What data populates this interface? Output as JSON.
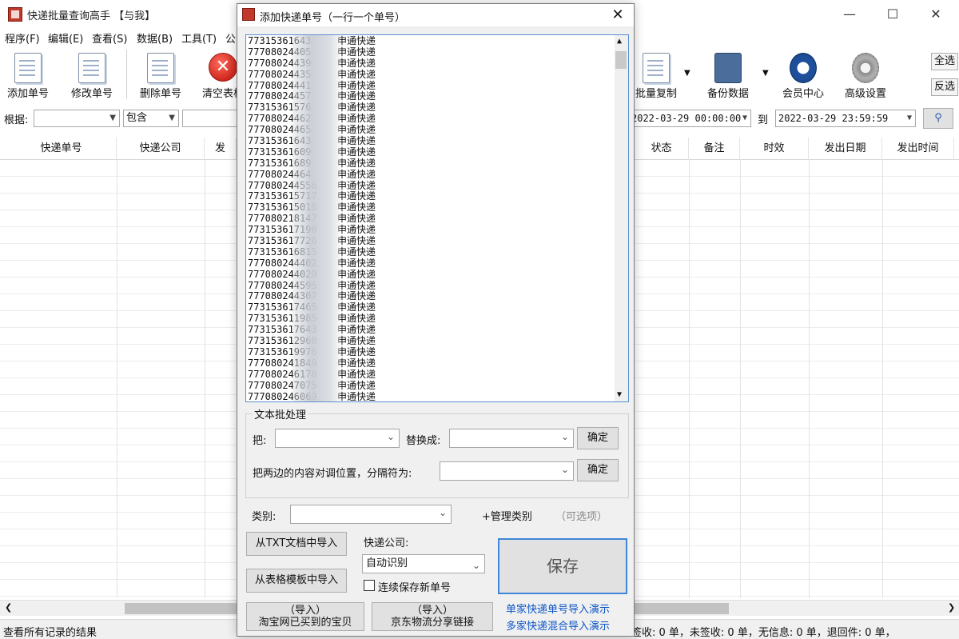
{
  "window": {
    "title": "快递批量查询高手 【与我】",
    "controls": {
      "minimize": "—",
      "maximize": "☐",
      "close": "✕"
    }
  },
  "menu": [
    "程序(F)",
    "编辑(E)",
    "查看(S)",
    "数据(B)",
    "工具(T)",
    "公"
  ],
  "toolbar": {
    "add": "添加单号",
    "edit": "修改单号",
    "delete": "删除单号",
    "clear": "清空表格",
    "batch_copy": "批量复制",
    "backup": "备份数据",
    "member": "会员中心",
    "advanced": "高级设置",
    "select_all": "全选",
    "invert": "反选"
  },
  "filter": {
    "by_label": "根据:",
    "condition": "包含",
    "date_from": "2022-03-29 00:00:00",
    "to_label": "到",
    "date_to": "2022-03-29 23:59:59"
  },
  "grid": {
    "columns_left": [
      "快递单号",
      "快递公司",
      "发"
    ],
    "columns_right": [
      "状态",
      "备注",
      "时效",
      "发出日期",
      "发出时间"
    ]
  },
  "status": {
    "left": "查看所有记录的结果",
    "right": "签收: 0 单，未签收: 0 单，无信息: 0 单，退回件: 0 单，"
  },
  "dialog": {
    "title": "添加快递单号（一行一个单号）",
    "close": "✕",
    "tracking_lines": [
      {
        "num": "77315361643",
        "co": "申通快递"
      },
      {
        "num": "77708024405",
        "co": "申通快递"
      },
      {
        "num": "77708024439",
        "co": "申通快递"
      },
      {
        "num": "77708024435",
        "co": "申通快递"
      },
      {
        "num": "77708024441",
        "co": "申通快递"
      },
      {
        "num": "77708024457",
        "co": "申通快递"
      },
      {
        "num": "77315361576",
        "co": "申通快递"
      },
      {
        "num": "77708024462",
        "co": "申通快递"
      },
      {
        "num": "77708024465",
        "co": "申通快递"
      },
      {
        "num": "77315361643",
        "co": "申通快递"
      },
      {
        "num": "77315361609",
        "co": "申通快递"
      },
      {
        "num": "77315361689",
        "co": "申通快递"
      },
      {
        "num": "77708024464",
        "co": "申通快递"
      },
      {
        "num": "777080244556",
        "co": "申通快递"
      },
      {
        "num": "773153615717",
        "co": "申通快递"
      },
      {
        "num": "773153615016",
        "co": "申通快递"
      },
      {
        "num": "777080218147",
        "co": "申通快递"
      },
      {
        "num": "773153617190",
        "co": "申通快递"
      },
      {
        "num": "773153617726",
        "co": "申通快递"
      },
      {
        "num": "773153616815",
        "co": "申通快递"
      },
      {
        "num": "777080244402",
        "co": "申通快递"
      },
      {
        "num": "777080244029",
        "co": "申通快递"
      },
      {
        "num": "777080244595",
        "co": "申通快递"
      },
      {
        "num": "777080244307",
        "co": "申通快递"
      },
      {
        "num": "773153617465",
        "co": "申通快递"
      },
      {
        "num": "773153611985",
        "co": "申通快递"
      },
      {
        "num": "773153617643",
        "co": "申通快递"
      },
      {
        "num": "773153612960",
        "co": "申通快递"
      },
      {
        "num": "773153619976",
        "co": "申通快递"
      },
      {
        "num": "777080241849",
        "co": "申通快递"
      },
      {
        "num": "777080246178",
        "co": "申通快递"
      },
      {
        "num": "777080247075",
        "co": "申通快递"
      },
      {
        "num": "777080246069",
        "co": "申通快递"
      }
    ],
    "batch_legend": "文本批处理",
    "replace_from_label": "把:",
    "replace_to_label": "替换成:",
    "confirm": "确定",
    "swap_label": "把两边的内容对调位置，分隔符为:",
    "category_label": "类别:",
    "manage_category": "+管理类别",
    "optional": "（可选项）",
    "import_txt": "从TXT文档中导入",
    "import_template": "从表格模板中导入",
    "courier_label": "快递公司:",
    "courier_value": "自动识别",
    "keep_saving": "连续保存新单号",
    "save": "保存",
    "import_taobao_top": "（导入）",
    "import_taobao": "淘宝网已买到的宝贝",
    "import_jd_top": "（导入）",
    "import_jd": "京东物流分享链接",
    "demo_single": "单家快递单号导入演示",
    "demo_multi": "多家快递混合导入演示"
  }
}
